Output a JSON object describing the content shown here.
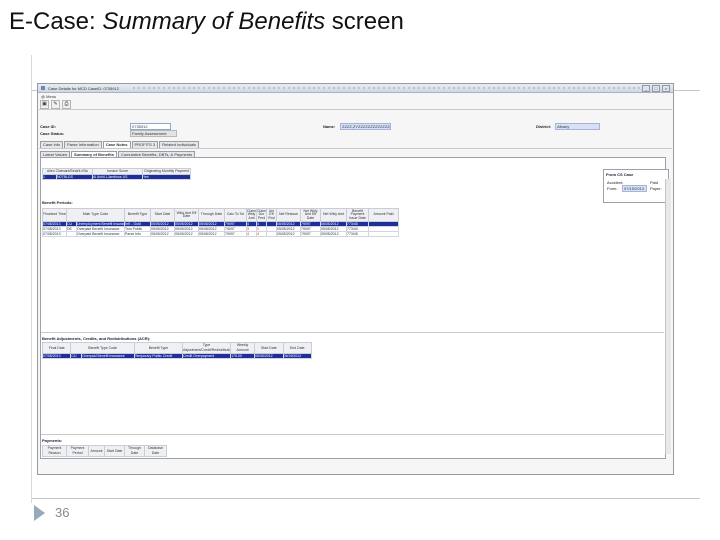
{
  "slide": {
    "title_prefix": "E-Case: ",
    "title_italic": "Summary of Benefits",
    "title_suffix": " screen",
    "page_number": "36"
  },
  "window": {
    "title": "Case Details for MCD CaseID: 0735912",
    "menu": "@ Menu",
    "buttons": {
      "minimize": "_",
      "maximize": "□",
      "close": "×"
    }
  },
  "header": {
    "case_id_label": "Case ID:",
    "case_id_value": "0735912",
    "case_status_label": "Case Status:",
    "case_status_value": "Family Assessment",
    "name_label": "Name:",
    "name_value": "ZZZZ,ZYZZZZZZZZZZZZZZ",
    "district_label": "District:",
    "district_value": "Albany"
  },
  "tabs": [
    "Case Info",
    "Parse Information",
    "Case Notes",
    "PROFITS 3",
    "Related Individuals"
  ],
  "subtabs": [
    "Latest Values",
    "Summary of Benefits",
    "Cumulative Benefits, DBTs, & Payments"
  ],
  "top_table": {
    "headers": [
      "Alien Claimant/Sectrit-l/Sic",
      "Invoice Score",
      "Originating Monthly Payment"
    ],
    "rows": [
      [
        "1",
        "N0TBLGS",
        "Al Anbil-l-Jamlinos US",
        "Yes"
      ]
    ]
  },
  "from_cs_case": {
    "title": "From CS Case",
    "accident_label": "Accident:",
    "accident_value": "Paid",
    "form_label": "Form:",
    "form_value": "07/15/2013",
    "payer_label": "Payer:"
  },
  "benefit_periods": {
    "title": "Benefit Periods:",
    "headers": [
      "Finalized Time",
      "Main Type Code",
      "Benefit Type",
      "Start Date",
      "Wkly Amt Eff Date",
      "Through Date",
      "Calc To Tot",
      "Claim Wkly Amt",
      "Claim Dur Perd",
      "Uni Eff Rnd",
      "Net Reissue",
      "Net Wkly Amt Eff Date",
      "Net Wkly Amt",
      "Benefit Payment Issue Date",
      "Amount Paid",
      "PB"
    ],
    "rows": [
      {
        "selected": true,
        "cells": [
          "07/08/2013",
          "CU",
          "Unemployment Benefit Insurance",
          "Int'l - Gold",
          "05/05/2012",
          "05/05/2012",
          "05/08/2012",
          "79097",
          "4",
          "4",
          "",
          "06/05/2012",
          "79097",
          "06/05/2012",
          "773/48",
          ""
        ]
      },
      {
        "selected": false,
        "cells": [
          "07/08/2013",
          "DE",
          "Overpaid Benefit Insurance",
          "Tom Public",
          "05/05/2012",
          "05/05/2012",
          "05/08/2012",
          "79097",
          "3",
          "1",
          "",
          "05/05/2012",
          "79097",
          "05/05/2012",
          "773/40",
          ""
        ]
      },
      {
        "selected": false,
        "cells": [
          "07/08/2013",
          "",
          "Overpaid Benefit Insurance",
          "Parse Info",
          "05/05/2012",
          "05/05/2012",
          "05/08/2012",
          "79097",
          "4",
          "4",
          "",
          "05/05/2012",
          "79097",
          "05/05/2012",
          "773/45",
          ""
        ]
      }
    ]
  },
  "adjustments": {
    "title": "Benefit Adjustments, Credits, and Redistributions (ACR):",
    "headers": [
      "Final Date",
      "Benefit Type Code",
      "Benefit Type",
      "Type Adjustment/Credit/Redistribution",
      "Weekly Amount",
      "Start Date",
      "End Date"
    ],
    "rows": [
      [
        "07/08/2013",
        "CU",
        "Overpaid Benefit Insurance",
        "Temporary Public Credit",
        "Credit Overpayment",
        "175.00",
        "05/05/2012",
        "05/19/2012"
      ]
    ]
  },
  "payments": {
    "title": "Payments:",
    "headers": [
      "Payment Reason",
      "Payment Period",
      "Amount",
      "Start Date",
      "Through Date",
      "Database Date"
    ]
  }
}
